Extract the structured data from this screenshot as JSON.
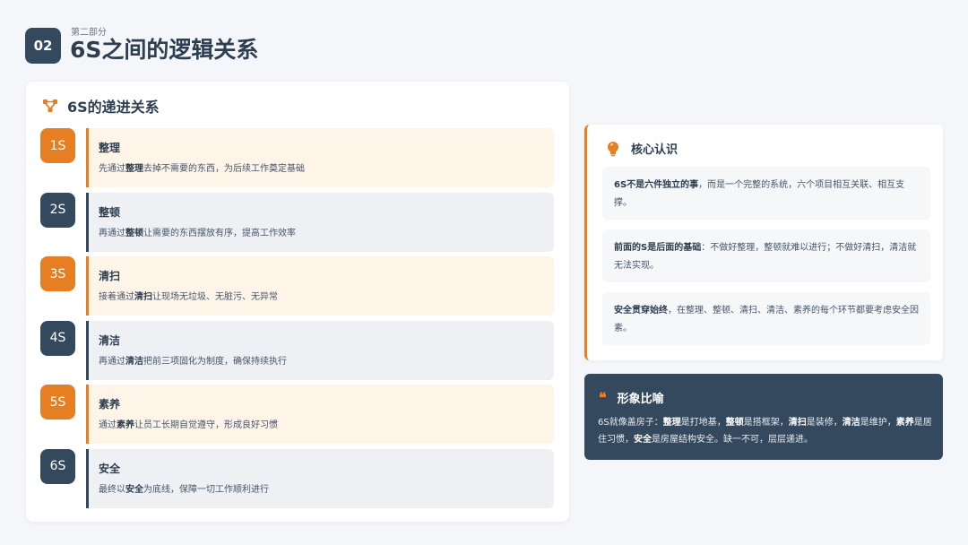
{
  "header": {
    "section_number": "02",
    "section_label": "第二部分",
    "title": "6S之间的逻辑关系"
  },
  "progression": {
    "heading": "6S的递进关系",
    "icon": "hierarchy-icon",
    "steps": [
      {
        "badge": "1S",
        "title": "整理",
        "pre": "先通过",
        "keyword": "整理",
        "post": "去掉不需要的东西，为后续工作奠定基础",
        "theme": "orange"
      },
      {
        "badge": "2S",
        "title": "整顿",
        "pre": "再通过",
        "keyword": "整顿",
        "post": "让需要的东西摆放有序，提高工作效率",
        "theme": "dark"
      },
      {
        "badge": "3S",
        "title": "清扫",
        "pre": "接着通过",
        "keyword": "清扫",
        "post": "让现场无垃圾、无脏污、无异常",
        "theme": "orange"
      },
      {
        "badge": "4S",
        "title": "清洁",
        "pre": "再通过",
        "keyword": "清洁",
        "post": "把前三项固化为制度，确保持续执行",
        "theme": "dark"
      },
      {
        "badge": "5S",
        "title": "素养",
        "pre": "通过",
        "keyword": "素养",
        "post": "让员工长期自觉遵守，形成良好习惯",
        "theme": "orange"
      },
      {
        "badge": "6S",
        "title": "安全",
        "pre": "最终以",
        "keyword": "安全",
        "post": "为底线，保障一切工作顺利进行",
        "theme": "dark"
      }
    ]
  },
  "core": {
    "heading": "核心认识",
    "icon": "lightbulb-icon",
    "items": [
      {
        "bold": "6S不是六件独立的事",
        "text": "，而是一个完整的系统，六个项目相互关联、相互支撑。"
      },
      {
        "bold": "前面的S是后面的基础",
        "text": "：不做好整理，整顿就难以进行；不做好清扫，清洁就无法实现。"
      },
      {
        "bold": "安全贯穿始终",
        "text": "，在整理、整顿、清扫、清洁、素养的每个环节都要考虑安全因素。"
      }
    ]
  },
  "metaphor": {
    "heading": "形象比喻",
    "icon": "quote-icon",
    "parts": {
      "p0": "6S就像盖房子：",
      "b1": "整理",
      "p1": "是打地基，",
      "b2": "整顿",
      "p2": "是搭框架，",
      "b3": "清扫",
      "p3": "是装修，",
      "b4": "清洁",
      "p4": "是维护，",
      "b5": "素养",
      "p5": "是居住习惯，",
      "b6": "安全",
      "p6": "是房屋结构安全。缺一不可，层层递进。"
    }
  },
  "colors": {
    "accent": "#e67e22",
    "dark": "#34495e",
    "orange_bg": "#fef4e8",
    "gray_bg": "#eef0f3"
  }
}
